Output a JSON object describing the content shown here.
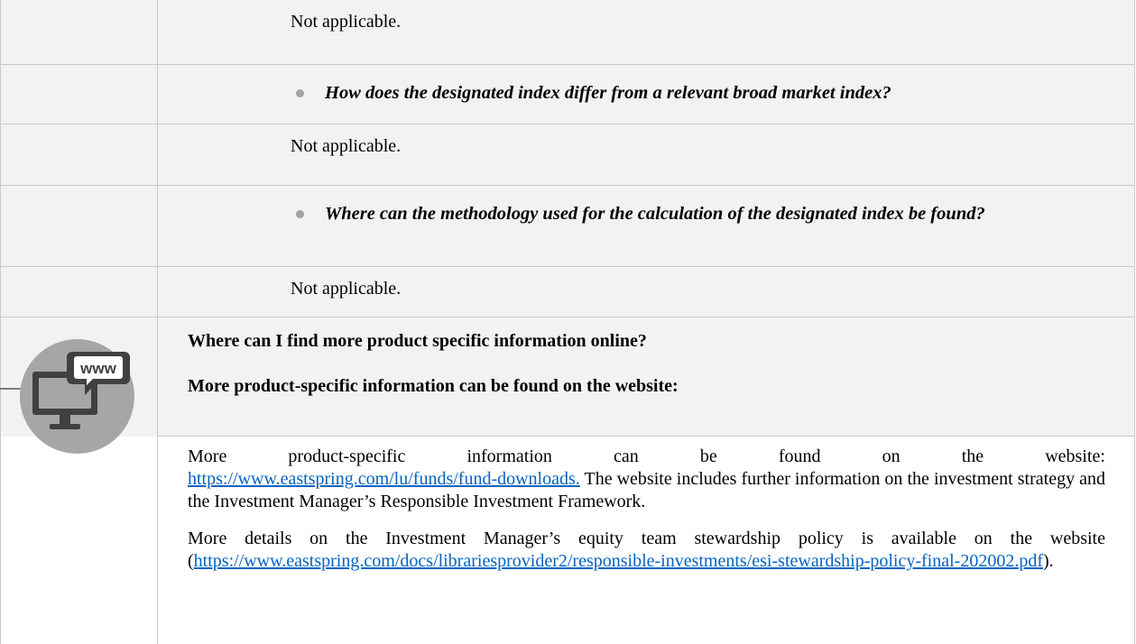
{
  "rows": [
    {
      "kind": "answer",
      "text": "Not applicable."
    },
    {
      "kind": "question",
      "text": "How does the designated index differ from a relevant broad market index?"
    },
    {
      "kind": "answer",
      "text": "Not applicable."
    },
    {
      "kind": "question",
      "text": "Where can the methodology used for the calculation of the designated index be found?"
    },
    {
      "kind": "answer",
      "text": "Not applicable."
    }
  ],
  "online": {
    "icon": "computer-www-icon",
    "icon_label": "www",
    "heading": "Where can I find more product specific information online?",
    "subheading": "More product-specific information can be found on the website:",
    "para1_words": [
      "More",
      "product-specific",
      "information",
      "can",
      "be",
      "found",
      "on",
      "the",
      "website:"
    ],
    "para1_link": "https://www.eastspring.com/lu/funds/fund-downloads.",
    "para1_rest": " The website includes further information on the investment strategy and the Investment Manager’s Responsible Investment Framework.",
    "para2_text": "More details on the Investment Manager’s equity team stewardship policy is available on the website",
    "para2_link_line1": "https://www.eastspring.com/docs/librariesprovider2/responsible-investments/esi-",
    "para2_link_line2": "stewardship-policy-final-202002.pdf",
    "para2_tail": ")."
  },
  "colors": {
    "cell_grey": "#f2f2f2",
    "border": "#c8c8c8",
    "link": "#0563c1",
    "icon_circle": "#a6a6a6",
    "icon_dark": "#404040"
  }
}
